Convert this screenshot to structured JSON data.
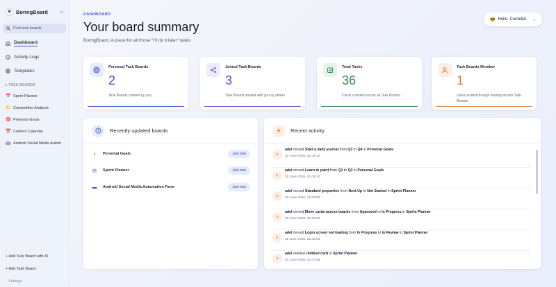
{
  "sidebar": {
    "brand_logo": "☻",
    "brand": "BoringBoard",
    "collapse_glyph": "«",
    "search_placeholder": "Find task boards",
    "nav": [
      {
        "label": "Dashboard",
        "icon": "home-icon"
      },
      {
        "label": "Activity Logs",
        "icon": "clock-icon"
      },
      {
        "label": "Templates",
        "icon": "globe-icon"
      }
    ],
    "section_title": "TASK BOARDS",
    "boards": [
      {
        "label": "Sprint Planner",
        "icon": "calendar-emoji"
      },
      {
        "label": "Competitive Analysis",
        "icon": "folder-emoji"
      },
      {
        "label": "Personal Goals",
        "icon": "target-emoji"
      },
      {
        "label": "Content Calendar",
        "icon": "calendar-emoji"
      },
      {
        "label": "Android Social Media Autom",
        "icon": "robot-emoji"
      }
    ],
    "add_ai": "+ Add Task Board with AI",
    "add_board": "+ Add Task Board",
    "settings": "Settings"
  },
  "header": {
    "eyebrow": "DASHBOARD",
    "title": "Your board summary",
    "subtitle": "BoringBoard, A place for all those \"I'll do it later\" tasks",
    "user_emoji": "😎",
    "user_greeting": "Hello, Cordelia!",
    "user_chevron": "⌄"
  },
  "stats": [
    {
      "label": "Personal Task Boards",
      "value": "2",
      "desc": "Task Boards created by you.",
      "color": "#3b4fd8",
      "icon_bg": "#e8ecfc",
      "icon": "◎"
    },
    {
      "label": "Joined Task Boards",
      "value": "3",
      "desc": "Task Boards shared with you by others.",
      "color": "#6a45d6",
      "icon_bg": "#eee9fc",
      "icon": "⟨"
    },
    {
      "label": "Total Tasks",
      "value": "36",
      "desc": "Cards counted across all Task Boards.",
      "color": "#2f8a4e",
      "icon_bg": "#e5f4ea",
      "icon": "✓"
    },
    {
      "label": "Task Boards Member",
      "value": "1",
      "desc": "Users invited through sharing across Task Boards.",
      "color": "#e07a3e",
      "icon_bg": "#fdeee6",
      "icon": "☺"
    }
  ],
  "recent_boards": {
    "title": "Recently updated boards",
    "icon": "◷",
    "items": [
      {
        "name": "Personal Goals",
        "badge": "Just now",
        "icon": "♪"
      },
      {
        "name": "Sprint Planner",
        "badge": "Just now",
        "icon": "▤"
      },
      {
        "name": "Android Social Media Automation Farm",
        "badge": "Just now",
        "icon": "▬"
      }
    ]
  },
  "activity": {
    "title": "Recent activity",
    "icon": "ϟ",
    "items": [
      {
        "user": "adel",
        "verb": "moved",
        "card": "Start a daily journal",
        "from": "Q3",
        "to": "Q4",
        "board": "Personal Goals",
        "time": "02 June 2026, 21:08:12"
      },
      {
        "user": "adel",
        "verb": "moved",
        "card": "Learn to paint",
        "from": "Q1",
        "to": "Q2",
        "board": "Personal Goals",
        "time": "02 June 2026, 21:08:10"
      },
      {
        "user": "adel",
        "verb": "moved",
        "card": "Standard properties",
        "from": "Next Up",
        "to": "Not Started",
        "board": "Sprint Planner",
        "time": "02 June 2026, 21:08:08"
      },
      {
        "user": "adel",
        "verb": "moved",
        "card": "Move cards across boards",
        "from": "Approved",
        "to": "In Progress",
        "board": "Sprint Planner",
        "time": "02 June 2026, 21:08:06"
      },
      {
        "user": "adel",
        "verb": "moved",
        "card": "Login screen not loading",
        "from": "In Progress",
        "to": "In Review",
        "board": "Sprint Planner",
        "time": "02 June 2026, 21:08:03"
      },
      {
        "user": "adel",
        "verb": "deleted",
        "card": "Untitled card",
        "from": "",
        "to": "",
        "board": "Sprint Planner",
        "time": "02 June 2026, 21:07:58"
      }
    ]
  }
}
